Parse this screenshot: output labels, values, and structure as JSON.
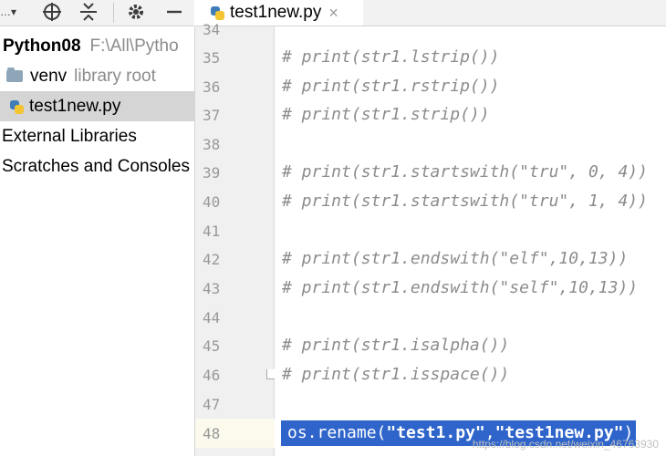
{
  "toolbar": {
    "dropdown_label": "…▾"
  },
  "tab": {
    "title": "test1new.py",
    "close_glyph": "×"
  },
  "project": {
    "root_name": "Python08",
    "root_path": "F:\\All\\Pytho",
    "items": [
      {
        "label": "venv",
        "hint": "library root"
      },
      {
        "label": "test1new.py"
      },
      {
        "label": "External Libraries"
      },
      {
        "label": "Scratches and Consoles"
      }
    ]
  },
  "editor": {
    "lines": [
      {
        "num": "34",
        "text": ""
      },
      {
        "num": "35",
        "text": "# print(str1.lstrip())"
      },
      {
        "num": "36",
        "text": "# print(str1.rstrip())"
      },
      {
        "num": "37",
        "text": "# print(str1.strip())"
      },
      {
        "num": "38",
        "text": ""
      },
      {
        "num": "39",
        "text": "# print(str1.startswith(\"tru\", 0, 4))"
      },
      {
        "num": "40",
        "text": "# print(str1.startswith(\"tru\", 1, 4))"
      },
      {
        "num": "41",
        "text": ""
      },
      {
        "num": "42",
        "text": "# print(str1.endswith(\"elf\",10,13))"
      },
      {
        "num": "43",
        "text": "# print(str1.endswith(\"self\",10,13))"
      },
      {
        "num": "44",
        "text": ""
      },
      {
        "num": "45",
        "text": "# print(str1.isalpha())"
      },
      {
        "num": "46",
        "text": "# print(str1.isspace())"
      },
      {
        "num": "47",
        "text": ""
      },
      {
        "num": "48",
        "code_prefix": "os.rename(",
        "arg1": "\"test1.py\"",
        "comma": ",",
        "arg2": "\"test1new.py\"",
        "code_suffix": ")"
      }
    ]
  },
  "watermark": "https://blog.csdn.net/weixin_46763930",
  "colors": {
    "selection": "#2f65ca",
    "comment": "#8c8c8c",
    "current_line": "#fcfaed"
  }
}
